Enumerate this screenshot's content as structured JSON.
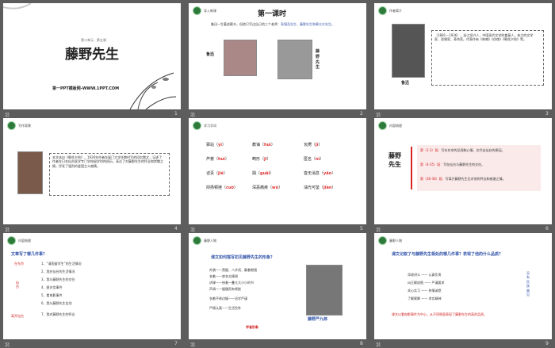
{
  "s1": {
    "unit": "第二单元 · 第五课",
    "title": "藤野先生",
    "footer": "第一PPT模板网-WWW.1PPT.COM",
    "num": "1"
  },
  "s2": {
    "badge": "导入新课",
    "title": "第一课时",
    "intro_a": "鲁迅一生著述颇丰，但他只写过自己的三个老师：",
    "intro_b": "寿镜吾先生、藤野先生和章太炎先生。",
    "lu": "鲁迅",
    "tengye": "藤野先生",
    "num": "2"
  },
  "s3": {
    "badge": "作者简介",
    "bio": "（1881—1936），浙江绍兴人，中国现代文学的奠基人，伟大的文学家、思想家、革命家。代表作有《呐喊》《彷徨》《朝花夕拾》等。",
    "name": "鲁迅",
    "num": "3"
  },
  "s4": {
    "badge": "写作背景",
    "text": "本文选自《朝花夕拾》，1926年作者在厦门大学任教时写的回忆散文，记述了作者在日本仙台医学专门学校留学时的经历，表达了对藤野先生的怀念和崇敬之情，抒发了强烈的爱国主义感情。",
    "num": "4"
  },
  "s5": {
    "badge": "学习字词",
    "words": [
      {
        "w": "驿站",
        "p": "yì"
      },
      {
        "w": "教诲",
        "p": "huì"
      },
      {
        "w": "瓦楞",
        "p": "jì"
      },
      {
        "w": "芦荟",
        "p": "huì"
      },
      {
        "w": "畸形",
        "p": "jī"
      },
      {
        "w": "匿名",
        "p": "nì"
      },
      {
        "w": "诘责",
        "p": "jié"
      },
      {
        "w": "掴",
        "p": "guāi"
      },
      {
        "w": "杳无消息",
        "p": "yǎo"
      },
      {
        "w": "抑扬顿挫",
        "p": "cuò"
      },
      {
        "w": "深恶痛疾",
        "p": "wù"
      },
      {
        "w": "油光可鉴",
        "p": "jiàn"
      }
    ],
    "num": "5"
  },
  "s6": {
    "badge": "内容梳理",
    "char_a": "藤野",
    "char_b": "先生",
    "items": [
      {
        "h": "第（1-3）段：",
        "t": "写在东京的见闻和心情，交代去仙台的原因。"
      },
      {
        "h": "第（4-35）段：",
        "t": "写在仙台与藤野先生的交往。"
      },
      {
        "h": "第（36-38）段：",
        "t": "写离开藤野先生后对他的怀念和感激之情。"
      }
    ],
    "num": "6"
  },
  "s7": {
    "badge": "内容梳理",
    "q": "文章写了哪几件事？",
    "left": [
      "在东京",
      "仙台",
      "离开仙台"
    ],
    "items": [
      "1、“清国留学生”的生活情况",
      "2、我在仙台的生活情况",
      "3、我与藤野先生的交往",
      "4、匿名信事件",
      "5、看电影事件",
      "6、我与藤野先生告别",
      "7、我对藤野先生的怀念"
    ],
    "num": "7"
  },
  "s8": {
    "badge": "藤野人物",
    "q": "课文如何描写初见藤野先生的形象？",
    "rows": [
      "外貌——黑瘦、八字须、戴着眼镜",
      "衣着——穿衣太模胡",
      "讲课——挟着一叠大大小小的书",
      "声调——缓慢而有顿挫",
      "衣着不修边幅——治学严谨",
      "严格认真——生活俭朴"
    ],
    "note": "学者形象",
    "name": "藤野严九郎",
    "num": "8"
  },
  "s9": {
    "badge": "藤野人物",
    "q": "课文记叙了与藤野先生相处的哪几件事？表现了他的什么品质？",
    "rows": [
      {
        "a": "添改讲义",
        "b": "认真负责"
      },
      {
        "a": "纠正解剖图",
        "b": "严谨要求"
      },
      {
        "a": "关心实习",
        "b": "热情诚恳"
      },
      {
        "a": "了解裹脚",
        "b": "求实精神"
      }
    ],
    "side": "没有民族偏见",
    "conc": "课文以看电影事件为中心，从不同侧面表现了藤野先生的高尚品质。",
    "num": "9"
  }
}
